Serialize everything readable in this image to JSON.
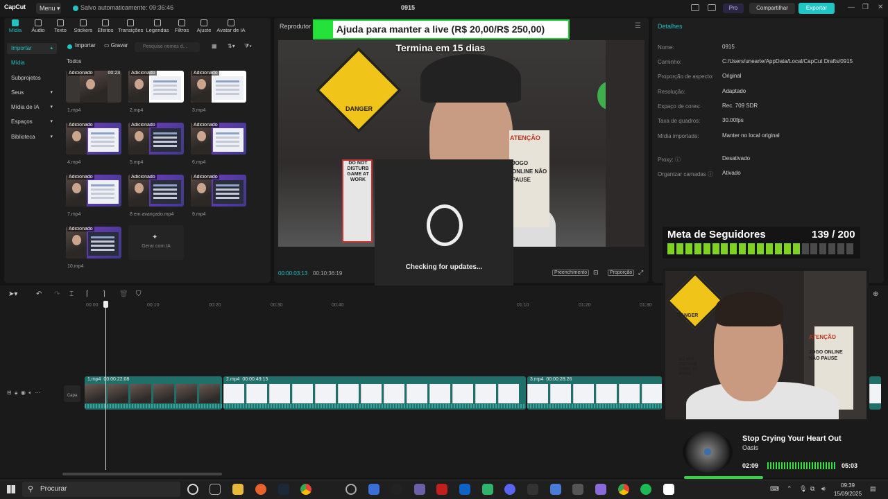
{
  "titlebar": {
    "logo": "CapCut",
    "menu": "Menu",
    "autosave": "Salvo automaticamente: 09:36:46",
    "project": "0915",
    "pro": "Pro",
    "share": "Compartilhar",
    "export": "Exportar"
  },
  "tabs": [
    "Mídia",
    "Áudio",
    "Texto",
    "Stickers",
    "Efeitos",
    "Transições",
    "Legendas",
    "Filtros",
    "Ajuste",
    "Avatar de IA"
  ],
  "sidebar": {
    "import": "Importar",
    "items": [
      "Mídia",
      "Subprojetos",
      "Seus",
      "Mídia de IA",
      "Espaços",
      "Biblioteca"
    ]
  },
  "media": {
    "import_btn": "Importar",
    "record_btn": "Gravar",
    "search_placeholder": "Pesquise nomes d...",
    "section": "Todos",
    "added_badge": "Adicionado",
    "first_duration": "00:23",
    "files": [
      "1.mp4",
      "2.mp4",
      "3.mp4",
      "4.mp4",
      "5.mp4",
      "6.mp4",
      "7.mp4",
      "8 em avançado.mp4",
      "9.mp4",
      "10.mp4"
    ],
    "gen_ai": "Gerar com IA"
  },
  "player": {
    "label": "Reprodutor",
    "current_time": "00:00:03:13",
    "total_time": "00:10:36:19",
    "fill": "Preenchimento",
    "ratio": "Proporção",
    "loader_text": "Checking for updates...",
    "donation": "Ajuda para manter a live (R$ 20,00/R$ 250,00)",
    "ends": "Termina em 15 dias",
    "scene_danger": "DANGER",
    "scene_dnd": "DO NOT DISTURB GAME AT WORK",
    "scene_atencao": "ATENÇÃO",
    "scene_jogo": "JOGO ONLINE NÃO PAUSE"
  },
  "details": {
    "title": "Detalhes",
    "rows": [
      {
        "k": "Nome:",
        "v": "0915"
      },
      {
        "k": "Caminho:",
        "v": "C:/Users/unearte/AppData/Local/CapCut Drafts/0915"
      },
      {
        "k": "Proporção de aspecto:",
        "v": "Original"
      },
      {
        "k": "Resolução:",
        "v": "Adaptado"
      },
      {
        "k": "Espaço de cores:",
        "v": "Rec. 709 SDR"
      },
      {
        "k": "Taxa de quadros:",
        "v": "30.00fps"
      },
      {
        "k": "Mídia importada:",
        "v": "Manter no local original"
      },
      {
        "k": "Proxy: ⓘ",
        "v": "Desativado"
      },
      {
        "k": "Organizar camadas ⓘ",
        "v": "Ativado"
      }
    ]
  },
  "goal": {
    "title": "Meta de Seguidores",
    "count": "139 / 200",
    "progress": 0.695
  },
  "timeline": {
    "ticks": [
      "00:00",
      "00:10",
      "00:20",
      "00:30",
      "00:40",
      "01:10",
      "01:20",
      "01:30"
    ],
    "cover": "Capa",
    "clips": [
      {
        "name": "1.mp4",
        "duration": "00:00:22:08"
      },
      {
        "name": "2.mp4",
        "duration": "00:00:49:15"
      },
      {
        "name": "3.mp4",
        "duration": "00:00:28:26"
      }
    ]
  },
  "webcam": {
    "danger": "DANGER",
    "atencao": "ATENÇÃO",
    "jogo": "JOGO ONLINE NÃO PAUSE",
    "dnd": "DO NOT DISTURB GAME AT WORK"
  },
  "music": {
    "title": "Stop Crying Your Heart Out",
    "artist": "Oasis",
    "current": "02:09",
    "total": "05:03",
    "progress": 0.43
  },
  "taskbar": {
    "search": "Procurar",
    "time": "09:39",
    "date": "15/09/2025"
  },
  "colors": {
    "accent": "#22c1c3",
    "export": "#1fc6c4",
    "goal_filled": "#7fd320",
    "goal_empty": "#4a4a4a",
    "music_green": "#2fd640"
  }
}
